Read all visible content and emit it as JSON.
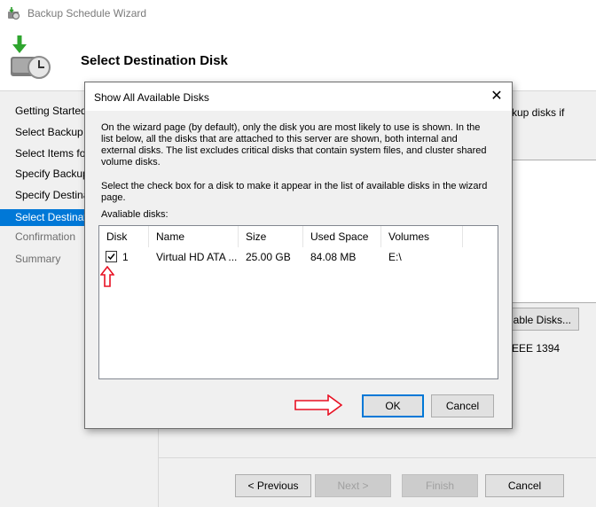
{
  "window": {
    "title": "Backup Schedule Wizard"
  },
  "header": {
    "title": "Select Destination Disk"
  },
  "nav": {
    "items": [
      {
        "label": "Getting Started",
        "state": "normal"
      },
      {
        "label": "Select Backup Configuration",
        "state": "normal"
      },
      {
        "label": "Select Items for Backup",
        "state": "normal"
      },
      {
        "label": "Specify Backup Time",
        "state": "normal"
      },
      {
        "label": "Specify Destination Type",
        "state": "normal"
      },
      {
        "label": "Select Destination Disk",
        "state": "active"
      },
      {
        "label": "Confirmation",
        "state": "dim"
      },
      {
        "label": "Summary",
        "state": "dim"
      }
    ]
  },
  "content": {
    "intro_fragment": "kup disks if",
    "show_all_button_fragment": "able Disks...",
    "note_fragment": "EEE 1394"
  },
  "footer": {
    "previous": "< Previous",
    "next": "Next >",
    "finish": "Finish",
    "cancel": "Cancel"
  },
  "dialog": {
    "title": "Show All Available Disks",
    "close_glyph": "✕",
    "text1": "On the wizard page (by default), only the disk you are most likely to use is shown. In the list below, all the disks that are attached to this server are shown, both internal and external disks. The list excludes critical disks that contain system files, and cluster shared volume disks.",
    "text2": "Select the check box for a disk to make it appear in the list of available disks in the wizard page.",
    "list_label": "Avaliable disks:",
    "columns": [
      "Disk",
      "Name",
      "Size",
      "Used Space",
      "Volumes"
    ],
    "rows": [
      {
        "checked": true,
        "disk": "1",
        "name": "Virtual HD ATA ...",
        "size": "25.00 GB",
        "used": "84.08 MB",
        "volumes": "E:\\"
      }
    ],
    "ok": "OK",
    "cancel": "Cancel"
  },
  "annotations": {
    "arrow_color": "#e81123",
    "up_arrow": "arrow-up-icon",
    "right_arrow": "arrow-right-icon"
  }
}
